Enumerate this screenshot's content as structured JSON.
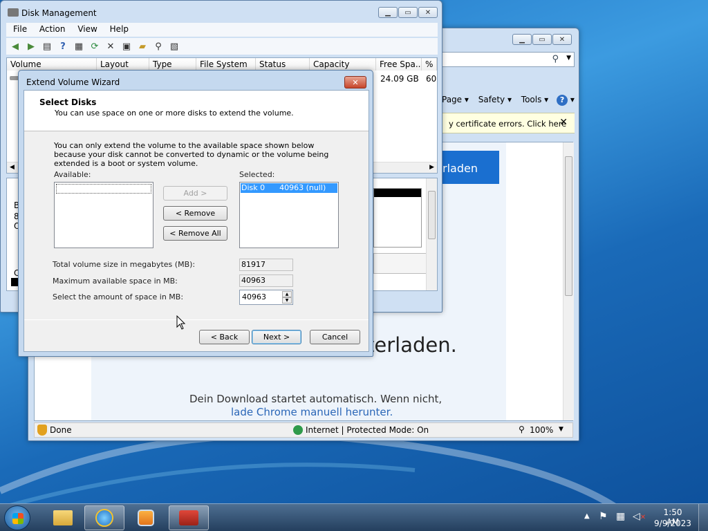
{
  "disk_mgmt": {
    "title": "Disk Management",
    "menu": [
      "File",
      "Action",
      "View",
      "Help"
    ],
    "columns": [
      "Volume",
      "Layout",
      "Type",
      "File System",
      "Status",
      "Capacity",
      "Free Spa...",
      "% F"
    ],
    "row": {
      "free": "24.09 GB",
      "pct": "60"
    },
    "left_fragments": [
      "B",
      "8",
      "O",
      "C"
    ]
  },
  "ie": {
    "toolbar": {
      "page": "Page",
      "safety": "Safety",
      "tools": "Tools"
    },
    "cert_bar": "y certificate errors. Click here",
    "download_button_fragment": "rladen",
    "heading_fragment": "terladen.",
    "notice_line1": "Dein Download startet automatisch. Wenn nicht,",
    "notice_link": "lade Chrome manuell herunter.",
    "status_done": "Done",
    "status_zone": "Internet | Protected Mode: On",
    "zoom": "100%"
  },
  "wizard": {
    "title": "Extend Volume Wizard",
    "header_title": "Select Disks",
    "header_subtitle": "You can use space on one or more disks to extend the volume.",
    "info": "You can only extend the volume to the available space shown below because your disk cannot be converted to dynamic or the volume being extended is a boot or system volume.",
    "available_label": "Available:",
    "selected_label": "Selected:",
    "selected_item": "Disk 0      40963 (null)",
    "add_label": "Add >",
    "remove_label": "< Remove",
    "remove_all_label": "< Remove All",
    "total_label": "Total volume size in megabytes (MB):",
    "total_value": "81917",
    "max_label": "Maximum available space in MB:",
    "max_value": "40963",
    "select_label": "Select the amount of space in MB:",
    "select_value": "40963",
    "back_label": "< Back",
    "next_label": "Next >",
    "cancel_label": "Cancel"
  },
  "taskbar": {
    "time": "1:50 AM",
    "date": "9/9/2023"
  },
  "colors": {
    "accent_blue": "#1a6fd0",
    "link": "#2a66b7",
    "cert_bar": "#ffffe1"
  }
}
